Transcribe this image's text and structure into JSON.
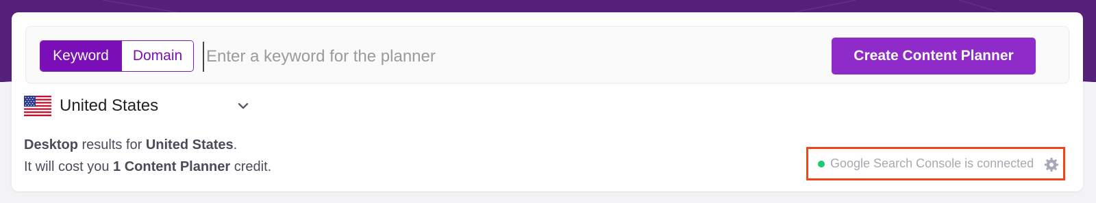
{
  "search": {
    "modes": [
      "Keyword",
      "Domain"
    ],
    "active_mode": "Keyword",
    "placeholder": "Enter a keyword for the planner",
    "value": "",
    "create_button": "Create Content Planner"
  },
  "country": {
    "label": "United States",
    "flag_icon": "us-flag-icon"
  },
  "info": {
    "line1_device": "Desktop",
    "line1_mid": " results for ",
    "line1_country": "United States",
    "line1_end": ".",
    "line2_start": "It will cost you ",
    "line2_cost": "1 Content Planner",
    "line2_end": " credit."
  },
  "integration": {
    "status_text": "Google Search Console is connected",
    "status_color": "#1ec871",
    "highlight_color": "#f04418"
  },
  "theme": {
    "brand_purple": "#7a0fb8",
    "button_purple": "#8e2bc9",
    "header_purple": "#55207a"
  }
}
